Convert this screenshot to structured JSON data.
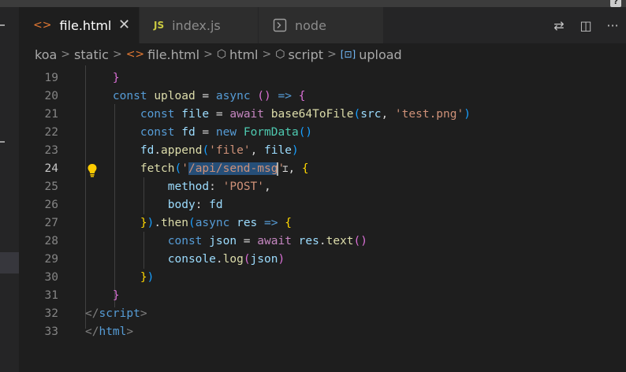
{
  "tabs": [
    {
      "label": "file.html",
      "icon": "<>",
      "active": true
    },
    {
      "label": "index.js",
      "icon": "JS",
      "active": false
    },
    {
      "label": "node",
      "icon": "terminal-icon",
      "active": false
    }
  ],
  "breadcrumb": [
    "koa",
    "static",
    "file.html",
    "html",
    "script",
    "upload"
  ],
  "line_numbers": [
    "19",
    "20",
    "21",
    "22",
    "23",
    "24",
    "25",
    "26",
    "27",
    "28",
    "29",
    "30",
    "31",
    "32",
    "33"
  ],
  "current_line": "24",
  "code": {
    "l21_file": "file",
    "l21_fn": "base64ToFile",
    "l21_src": "src",
    "l21_str": "'test.png'",
    "l22_fd": "fd",
    "l22_cls": "FormData",
    "l23_fd": "fd",
    "l23_fn": "append",
    "l23_str": "'file'",
    "l23_arg": "file",
    "l24_fn": "fetch",
    "l24_selected": "/api/send-msg",
    "l25_key": "method",
    "l25_str": "'POST'",
    "l26_key": "body",
    "l26_val": "fd",
    "l27_fn": "then",
    "l27_param": "res",
    "l28_var": "json",
    "l28_obj": "res",
    "l28_fn": "text",
    "l29_obj": "console",
    "l29_fn": "log",
    "l29_arg": "json",
    "l32_tag": "script",
    "l33_tag": "html"
  }
}
